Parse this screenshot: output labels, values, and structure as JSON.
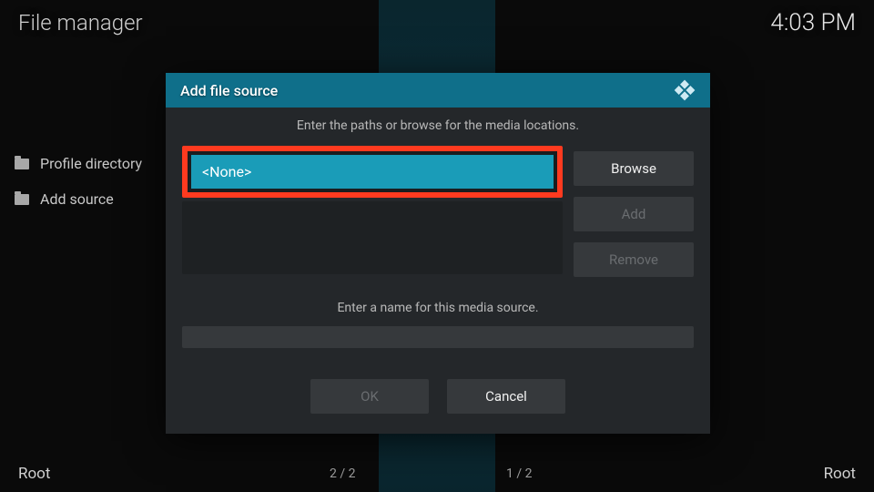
{
  "header": {
    "title": "File manager",
    "clock": "4:03 PM"
  },
  "sidebar": {
    "items": [
      {
        "label": "Profile directory"
      },
      {
        "label": "Add source"
      }
    ]
  },
  "dialog": {
    "title": "Add file source",
    "path_instruction": "Enter the paths or browse for the media locations.",
    "path_value": "<None>",
    "browse_label": "Browse",
    "add_label": "Add",
    "remove_label": "Remove",
    "name_instruction": "Enter a name for this media source.",
    "name_value": "",
    "ok_label": "OK",
    "cancel_label": "Cancel"
  },
  "footer": {
    "left_label": "Root",
    "left_count": "2 / 2",
    "right_count": "1 / 2",
    "right_label": "Root"
  }
}
